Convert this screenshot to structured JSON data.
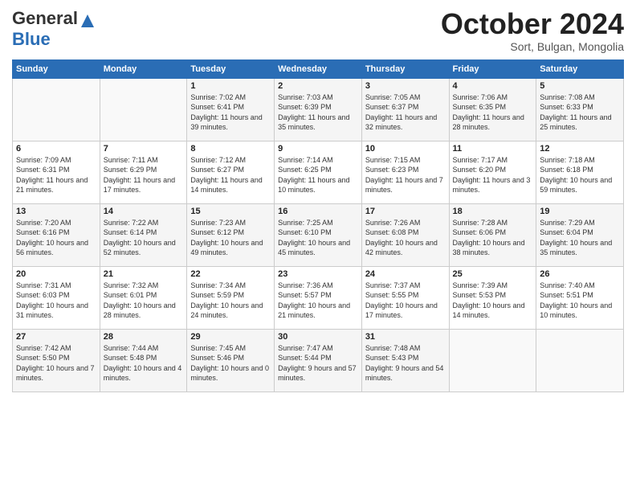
{
  "header": {
    "logo_general": "General",
    "logo_blue": "Blue",
    "month_title": "October 2024",
    "subtitle": "Sort, Bulgan, Mongolia"
  },
  "days_of_week": [
    "Sunday",
    "Monday",
    "Tuesday",
    "Wednesday",
    "Thursday",
    "Friday",
    "Saturday"
  ],
  "weeks": [
    [
      {
        "day": "",
        "info": ""
      },
      {
        "day": "",
        "info": ""
      },
      {
        "day": "1",
        "info": "Sunrise: 7:02 AM\nSunset: 6:41 PM\nDaylight: 11 hours and 39 minutes."
      },
      {
        "day": "2",
        "info": "Sunrise: 7:03 AM\nSunset: 6:39 PM\nDaylight: 11 hours and 35 minutes."
      },
      {
        "day": "3",
        "info": "Sunrise: 7:05 AM\nSunset: 6:37 PM\nDaylight: 11 hours and 32 minutes."
      },
      {
        "day": "4",
        "info": "Sunrise: 7:06 AM\nSunset: 6:35 PM\nDaylight: 11 hours and 28 minutes."
      },
      {
        "day": "5",
        "info": "Sunrise: 7:08 AM\nSunset: 6:33 PM\nDaylight: 11 hours and 25 minutes."
      }
    ],
    [
      {
        "day": "6",
        "info": "Sunrise: 7:09 AM\nSunset: 6:31 PM\nDaylight: 11 hours and 21 minutes."
      },
      {
        "day": "7",
        "info": "Sunrise: 7:11 AM\nSunset: 6:29 PM\nDaylight: 11 hours and 17 minutes."
      },
      {
        "day": "8",
        "info": "Sunrise: 7:12 AM\nSunset: 6:27 PM\nDaylight: 11 hours and 14 minutes."
      },
      {
        "day": "9",
        "info": "Sunrise: 7:14 AM\nSunset: 6:25 PM\nDaylight: 11 hours and 10 minutes."
      },
      {
        "day": "10",
        "info": "Sunrise: 7:15 AM\nSunset: 6:23 PM\nDaylight: 11 hours and 7 minutes."
      },
      {
        "day": "11",
        "info": "Sunrise: 7:17 AM\nSunset: 6:20 PM\nDaylight: 11 hours and 3 minutes."
      },
      {
        "day": "12",
        "info": "Sunrise: 7:18 AM\nSunset: 6:18 PM\nDaylight: 10 hours and 59 minutes."
      }
    ],
    [
      {
        "day": "13",
        "info": "Sunrise: 7:20 AM\nSunset: 6:16 PM\nDaylight: 10 hours and 56 minutes."
      },
      {
        "day": "14",
        "info": "Sunrise: 7:22 AM\nSunset: 6:14 PM\nDaylight: 10 hours and 52 minutes."
      },
      {
        "day": "15",
        "info": "Sunrise: 7:23 AM\nSunset: 6:12 PM\nDaylight: 10 hours and 49 minutes."
      },
      {
        "day": "16",
        "info": "Sunrise: 7:25 AM\nSunset: 6:10 PM\nDaylight: 10 hours and 45 minutes."
      },
      {
        "day": "17",
        "info": "Sunrise: 7:26 AM\nSunset: 6:08 PM\nDaylight: 10 hours and 42 minutes."
      },
      {
        "day": "18",
        "info": "Sunrise: 7:28 AM\nSunset: 6:06 PM\nDaylight: 10 hours and 38 minutes."
      },
      {
        "day": "19",
        "info": "Sunrise: 7:29 AM\nSunset: 6:04 PM\nDaylight: 10 hours and 35 minutes."
      }
    ],
    [
      {
        "day": "20",
        "info": "Sunrise: 7:31 AM\nSunset: 6:03 PM\nDaylight: 10 hours and 31 minutes."
      },
      {
        "day": "21",
        "info": "Sunrise: 7:32 AM\nSunset: 6:01 PM\nDaylight: 10 hours and 28 minutes."
      },
      {
        "day": "22",
        "info": "Sunrise: 7:34 AM\nSunset: 5:59 PM\nDaylight: 10 hours and 24 minutes."
      },
      {
        "day": "23",
        "info": "Sunrise: 7:36 AM\nSunset: 5:57 PM\nDaylight: 10 hours and 21 minutes."
      },
      {
        "day": "24",
        "info": "Sunrise: 7:37 AM\nSunset: 5:55 PM\nDaylight: 10 hours and 17 minutes."
      },
      {
        "day": "25",
        "info": "Sunrise: 7:39 AM\nSunset: 5:53 PM\nDaylight: 10 hours and 14 minutes."
      },
      {
        "day": "26",
        "info": "Sunrise: 7:40 AM\nSunset: 5:51 PM\nDaylight: 10 hours and 10 minutes."
      }
    ],
    [
      {
        "day": "27",
        "info": "Sunrise: 7:42 AM\nSunset: 5:50 PM\nDaylight: 10 hours and 7 minutes."
      },
      {
        "day": "28",
        "info": "Sunrise: 7:44 AM\nSunset: 5:48 PM\nDaylight: 10 hours and 4 minutes."
      },
      {
        "day": "29",
        "info": "Sunrise: 7:45 AM\nSunset: 5:46 PM\nDaylight: 10 hours and 0 minutes."
      },
      {
        "day": "30",
        "info": "Sunrise: 7:47 AM\nSunset: 5:44 PM\nDaylight: 9 hours and 57 minutes."
      },
      {
        "day": "31",
        "info": "Sunrise: 7:48 AM\nSunset: 5:43 PM\nDaylight: 9 hours and 54 minutes."
      },
      {
        "day": "",
        "info": ""
      },
      {
        "day": "",
        "info": ""
      }
    ]
  ]
}
